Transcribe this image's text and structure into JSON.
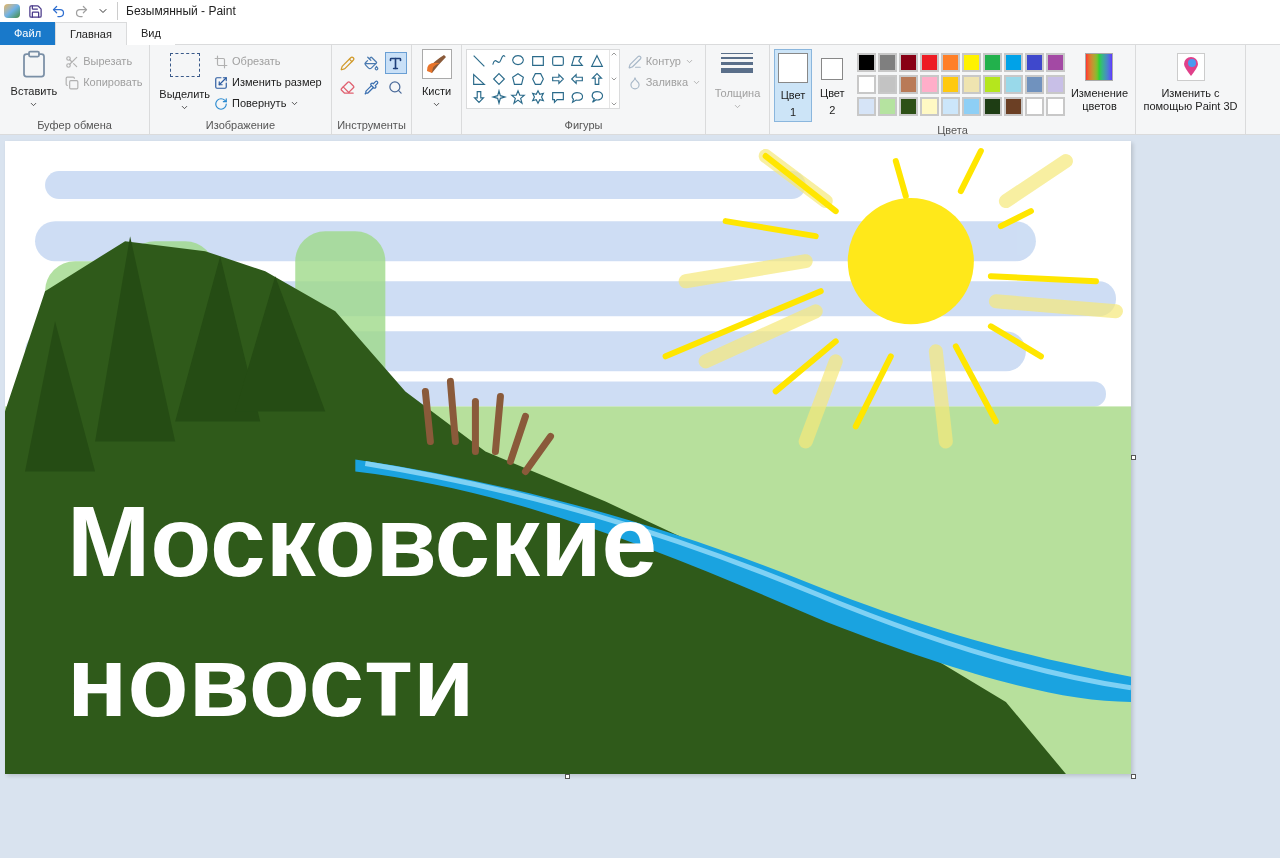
{
  "window": {
    "title": "Безымянный - Paint"
  },
  "tabs": [
    {
      "label": "Файл",
      "kind": "file",
      "selected": false
    },
    {
      "label": "Главная",
      "kind": "tab",
      "selected": true
    },
    {
      "label": "Вид",
      "kind": "tab",
      "selected": false
    }
  ],
  "clipboard": {
    "paste": "Вставить",
    "cut": {
      "label": "Вырезать",
      "disabled": true
    },
    "copy": {
      "label": "Копировать",
      "disabled": true
    },
    "caption": "Буфер обмена"
  },
  "image": {
    "select": "Выделить",
    "crop": {
      "label": "Обрезать",
      "disabled": true
    },
    "resize": {
      "label": "Изменить размер",
      "disabled": false
    },
    "rotate": {
      "label": "Повернуть",
      "disabled": false
    },
    "caption": "Изображение"
  },
  "tools": {
    "items": [
      {
        "kind": "pencil",
        "selected": false
      },
      {
        "kind": "fill",
        "selected": false
      },
      {
        "kind": "text",
        "selected": true
      },
      {
        "kind": "eraser",
        "selected": false
      },
      {
        "kind": "picker",
        "selected": false
      },
      {
        "kind": "magnifier",
        "selected": false
      }
    ],
    "caption": "Инструменты"
  },
  "brushes": {
    "label": "Кисти"
  },
  "shapes": {
    "outline": {
      "label": "Контур",
      "disabled": true
    },
    "fill": {
      "label": "Заливка",
      "disabled": true
    },
    "caption": "Фигуры"
  },
  "size": {
    "label": "Толщина",
    "disabled": true
  },
  "color_slots": [
    {
      "label": "Цвет",
      "number": "1",
      "selected": true
    },
    {
      "label": "Цвет",
      "number": "2",
      "selected": false
    }
  ],
  "palette": [
    {
      "color": "#000000"
    },
    {
      "color": "#7f7f7f"
    },
    {
      "color": "#880015"
    },
    {
      "color": "#ed1c24"
    },
    {
      "color": "#ff7f27"
    },
    {
      "color": "#fff200"
    },
    {
      "color": "#22b14c"
    },
    {
      "color": "#00a2e8"
    },
    {
      "color": "#3f48cc"
    },
    {
      "color": "#a349a4"
    },
    {
      "color": "#ffffff"
    },
    {
      "color": "#c3c3c3"
    },
    {
      "color": "#b97a57"
    },
    {
      "color": "#ffaec9"
    },
    {
      "color": "#ffc90e"
    },
    {
      "color": "#efe4b0"
    },
    {
      "color": "#b5e61d"
    },
    {
      "color": "#99d9ea"
    },
    {
      "color": "#7092be"
    },
    {
      "color": "#c8bfe7"
    },
    {
      "color": "#d6e4f7"
    },
    {
      "color": "#b5e3a0"
    },
    {
      "color": "#2d5016"
    },
    {
      "color": "#fff9c4"
    },
    {
      "color": "#cce6fa"
    },
    {
      "color": "#8ecff5"
    },
    {
      "color": "#1e3d14"
    },
    {
      "color": "#6b3f24"
    },
    {
      "color": "#ffffff"
    },
    {
      "color": "#ffffff"
    }
  ],
  "colors_caption": "Цвета",
  "edit_colors": "Изменение цветов",
  "paint3d": "Изменить с помощью Paint 3D",
  "canvas": {
    "text_lines": [
      "Московские",
      "новости"
    ]
  }
}
